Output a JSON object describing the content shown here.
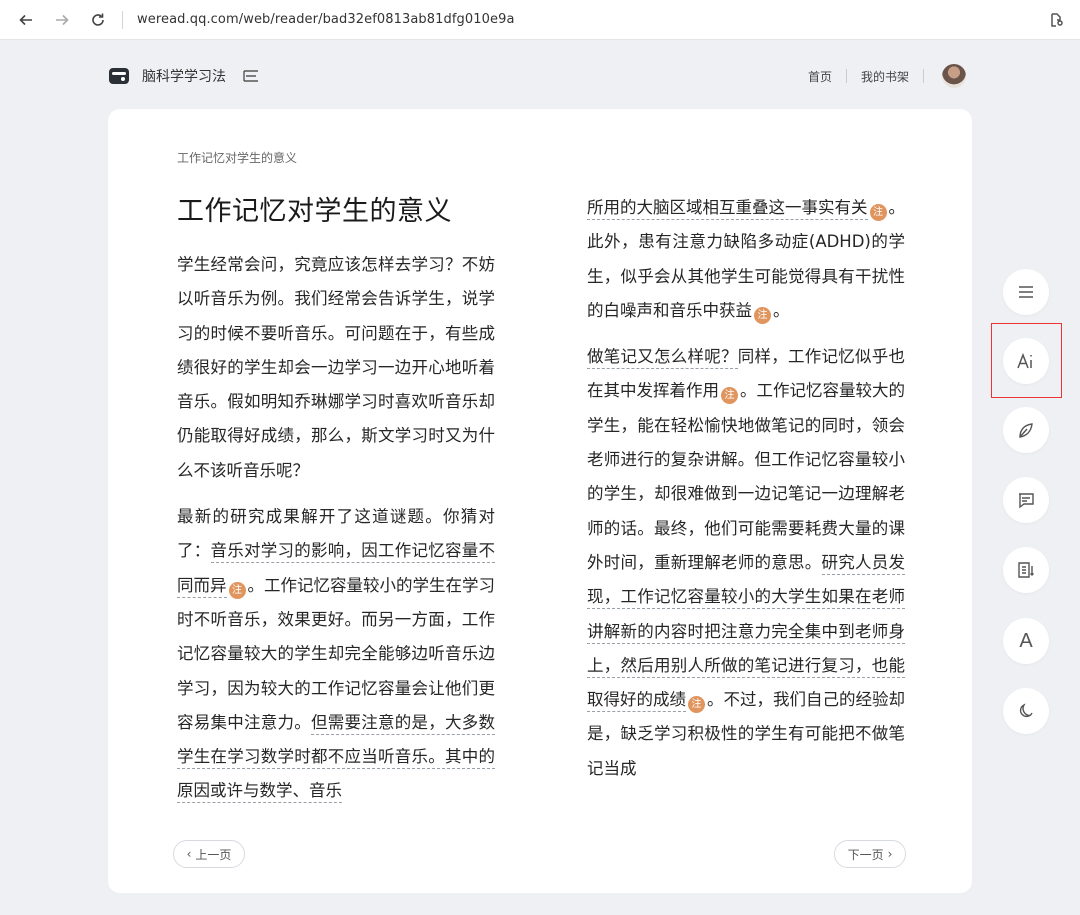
{
  "browser": {
    "url": "weread.qq.com/web/reader/bad32ef0813ab81dfg010e9a"
  },
  "header": {
    "book_title": "脑科学学习法",
    "links": {
      "home": "首页",
      "bookshelf": "我的书架"
    }
  },
  "page": {
    "running_title": "工作记忆对学生的意义",
    "chapter_title": "工作记忆对学生的意义",
    "note_glyph": "注",
    "left": {
      "p1": "学生经常会问，究竟应该怎样去学习？不妨以听音乐为例。我们经常会告诉学生，说学习的时候不要听音乐。可问题在于，有些成绩很好的学生却会一边学习一边开心地听着音乐。假如明知乔琳娜学习时喜欢听音乐却仍能取得好成绩，那么，斯文学习时又为什么不该听音乐呢？",
      "p2_a": "最新的研究成果解开了这道谜题。你猜对了：",
      "p2_u1": "音乐对学习的影响，因工作记忆容量不同而异",
      "p2_b": "。工作记忆容量较小的学生在学习时不听音乐，效果更好。而另一方面，工作记忆容量较大的学生却完全能够边听音乐边学习，因为较大的工作记忆容量会让他们更容易集中注意力。",
      "p2_u2": "但需要注意的是，大多数学生在学习数学时都不应当听音乐。其中的原因或许与数学、音乐"
    },
    "right": {
      "p1_u": "所用的大脑区域相互重叠这一事实有关",
      "p1_b": "。此外，患有注意力缺陷多动症(ADHD)的学生，似乎会从其他学生可能觉得具有干扰性的白噪声和音乐中获益",
      "p1_c": "。",
      "p2_u1": "做笔记又怎么样呢？",
      "p2_a": "同样，工作记忆似乎也在其中发挥着作用",
      "p2_b": "。工作记忆容量较大的学生，能在轻松愉快地做笔记的同时，领会老师进行的复杂讲解。但工作记忆容量较小的学生，却很难做到一边记笔记一边理解老师的话。最终，他们可能需要耗费大量的课外时间，重新理解老师的意思。",
      "p2_u2": "研究人员发现，工作记忆容量较小的大学生如果在老师讲解新的内容时把注意力完全集中到老师身上，然后用别人所做的笔记进行复习，也能取得好的成绩",
      "p2_c": "。不过，我们自己的经验却是，缺乏学习积极性的学生有可能把不做笔记当成"
    },
    "pager": {
      "prev": "上一页",
      "next": "下一页"
    }
  },
  "tools": [
    {
      "name": "toc",
      "icon": "list-icon"
    },
    {
      "name": "font-size",
      "icon": "ai-text-icon"
    },
    {
      "name": "notes",
      "icon": "feather-icon"
    },
    {
      "name": "comments",
      "icon": "message-icon"
    },
    {
      "name": "bookmarks",
      "icon": "notes-list-icon"
    },
    {
      "name": "font",
      "icon": "letter-a-icon",
      "label": "A"
    },
    {
      "name": "dark-mode",
      "icon": "moon-icon"
    }
  ],
  "colors": {
    "background": "#eef0f4",
    "note_badge": "#e0955e",
    "highlight_box": "#e33333"
  }
}
